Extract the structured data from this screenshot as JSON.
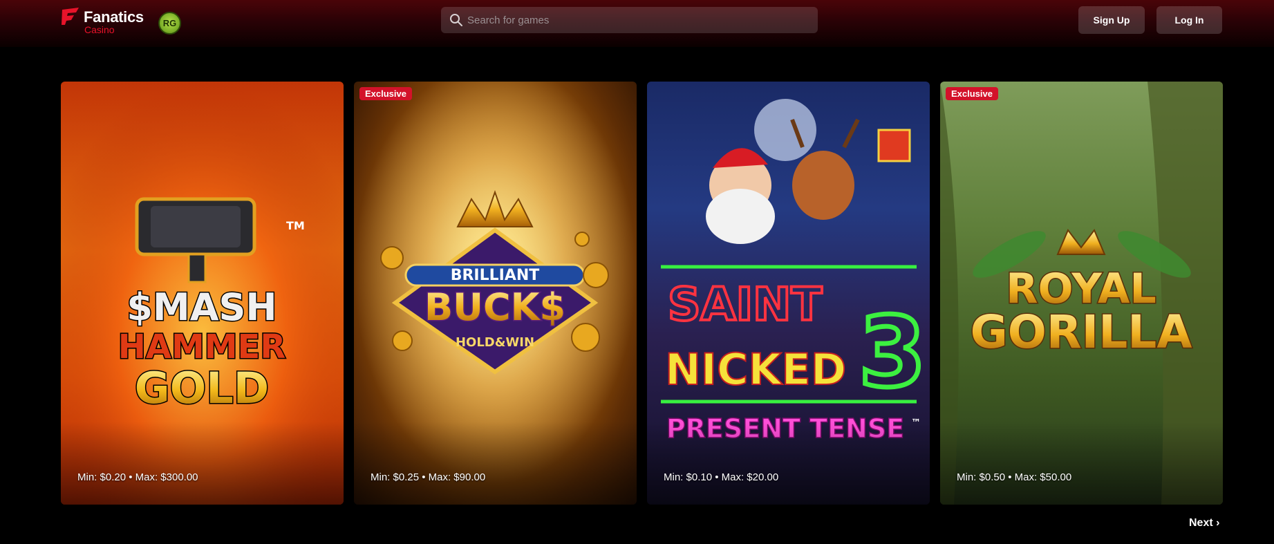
{
  "header": {
    "logo_name": "Fanatics",
    "logo_sub": "Casino",
    "rg_badge": "RG",
    "search_placeholder": "Search for games",
    "signup_label": "Sign Up",
    "login_label": "Log In"
  },
  "cards": [
    {
      "title_lines": [
        "$MASH",
        "HAMMER",
        "GOLD"
      ],
      "trademark": "TM",
      "badge": "",
      "limits": "Min: $0.20 • Max: $300.00"
    },
    {
      "title_lines": [
        "BRILLIANT",
        "BUCK$",
        "HOLD&WIN"
      ],
      "badge": "Exclusive",
      "limits": "Min: $0.25 • Max: $90.00"
    },
    {
      "title_lines": [
        "SAINT",
        "NICKED",
        "3",
        "PRESENT TENSE"
      ],
      "trademark": "™",
      "badge": "",
      "limits": "Min: $0.10 • Max: $20.00"
    },
    {
      "title_lines": [
        "ROYAL",
        "GORILLA"
      ],
      "badge": "Exclusive",
      "limits": "Min: $0.50 • Max: $50.00"
    }
  ],
  "pagination": {
    "next_label": "Next ›"
  },
  "colors": {
    "brand_red": "#e8132a",
    "exclusive_badge": "#d3122a",
    "header_bg": "#2a0206"
  }
}
